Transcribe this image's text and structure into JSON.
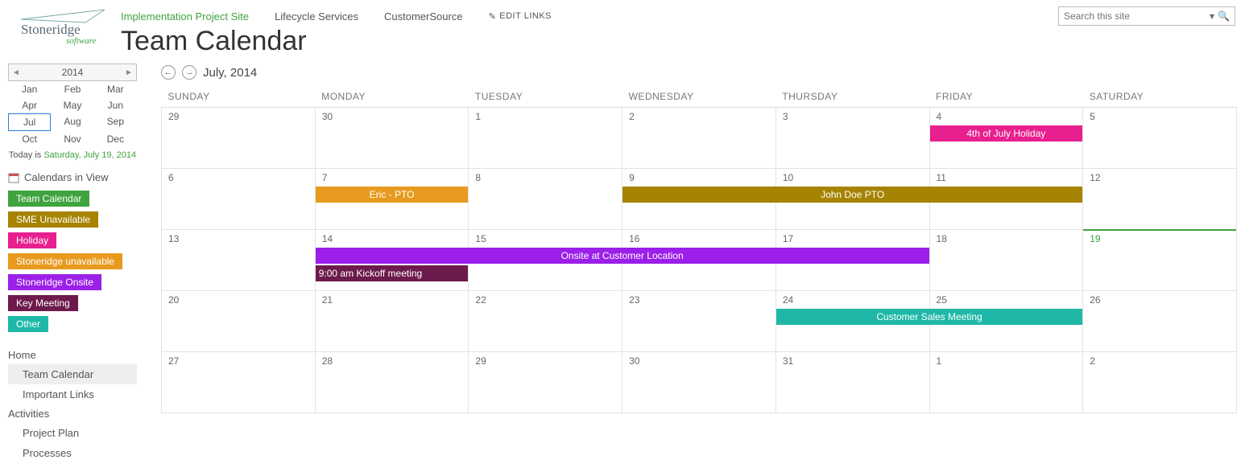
{
  "header": {
    "nav": {
      "implementation": "Implementation Project Site",
      "lifecycle": "Lifecycle Services",
      "customersource": "CustomerSource",
      "edit_links": "EDIT LINKS"
    },
    "page_title": "Team Calendar",
    "search": {
      "placeholder": "Search this site"
    },
    "logo": {
      "main": "Stoneridge",
      "sub": "software"
    }
  },
  "sidebar": {
    "year": "2014",
    "months": [
      "Jan",
      "Feb",
      "Mar",
      "Apr",
      "May",
      "Jun",
      "Jul",
      "Aug",
      "Sep",
      "Oct",
      "Nov",
      "Dec"
    ],
    "selected_month_index": 6,
    "today_prefix": "Today is ",
    "today_date": "Saturday, July 19, 2014",
    "calendars_in_view_label": "Calendars in View",
    "legend": [
      {
        "label": "Team Calendar",
        "color": "#3fa33f"
      },
      {
        "label": "SME Unavailable",
        "color": "#a68300"
      },
      {
        "label": "Holiday",
        "color": "#e81f8e"
      },
      {
        "label": "Stoneridge unavailable",
        "color": "#e89a1f"
      },
      {
        "label": "Stoneridge Onsite",
        "color": "#9b1fe8"
      },
      {
        "label": "Key Meeting",
        "color": "#6d1a4d"
      },
      {
        "label": "Other",
        "color": "#1fb8a8"
      }
    ],
    "nav": {
      "home": "Home",
      "team_calendar": "Team Calendar",
      "important_links": "Important Links",
      "activities": "Activities",
      "project_plan": "Project Plan",
      "processes": "Processes"
    }
  },
  "calendar": {
    "title": "July, 2014",
    "day_headers": [
      "SUNDAY",
      "MONDAY",
      "TUESDAY",
      "WEDNESDAY",
      "THURSDAY",
      "FRIDAY",
      "SATURDAY"
    ],
    "weeks": [
      [
        "29",
        "30",
        "1",
        "2",
        "3",
        "4",
        "5"
      ],
      [
        "6",
        "7",
        "8",
        "9",
        "10",
        "11",
        "12"
      ],
      [
        "13",
        "14",
        "15",
        "16",
        "17",
        "18",
        "19"
      ],
      [
        "20",
        "21",
        "22",
        "23",
        "24",
        "25",
        "26"
      ],
      [
        "27",
        "28",
        "29",
        "30",
        "31",
        "1",
        "2"
      ]
    ],
    "today_cell": {
      "week": 2,
      "col": 6
    },
    "events": {
      "fourth_july": "4th of July Holiday",
      "eric_pto": "Eric - PTO",
      "john_doe_pto": "John Doe PTO",
      "onsite": "Onsite at Customer Location",
      "kickoff": "9:00 am Kickoff meeting",
      "sales_meeting": "Customer Sales Meeting"
    }
  }
}
